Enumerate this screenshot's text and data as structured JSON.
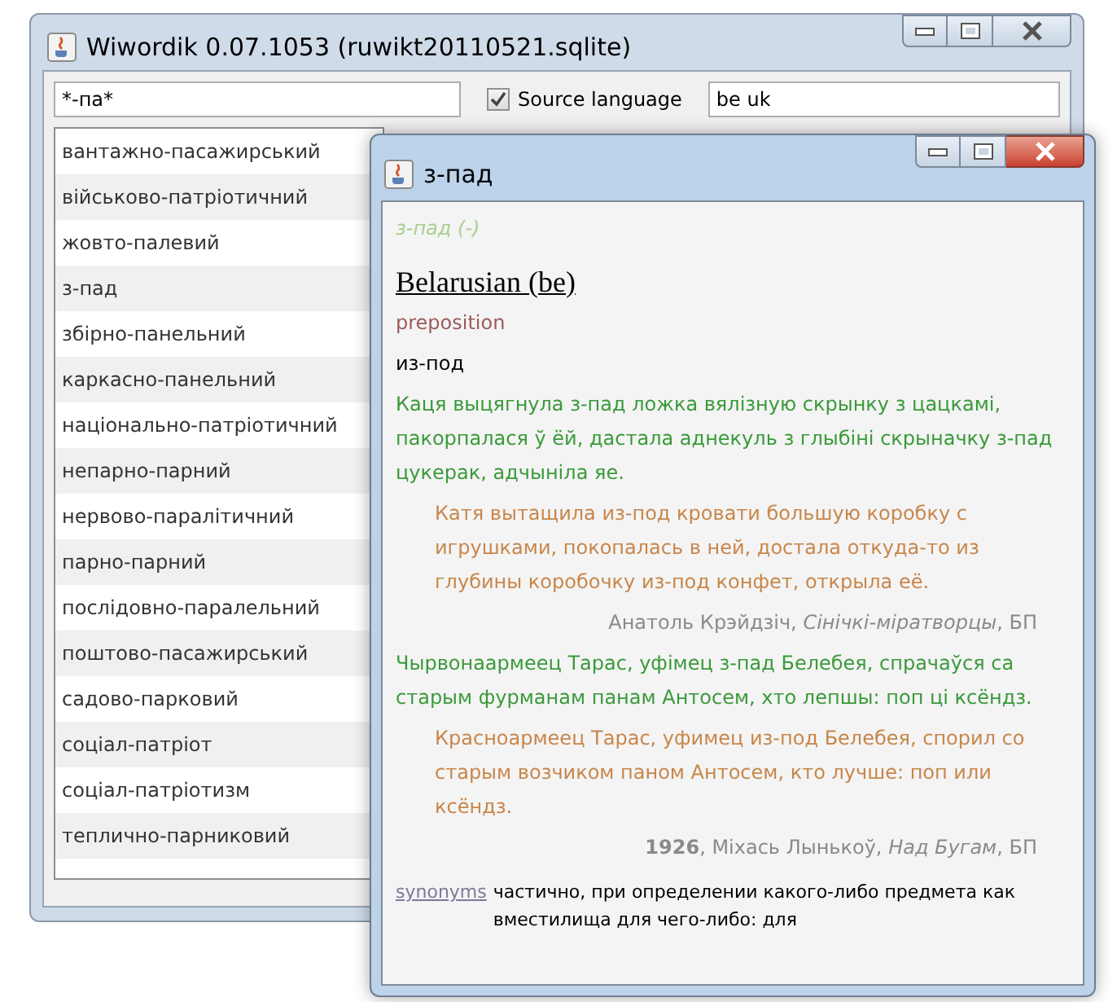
{
  "main_window": {
    "title": "Wiwordik 0.07.1053 (ruwikt20110521.sqlite)",
    "search": {
      "value": "*-па*"
    },
    "source_language": {
      "label": "Source language",
      "checked": true
    },
    "languages": {
      "value": "be uk"
    },
    "words": [
      "вантажно-пасажирський",
      "військово-патріотичний",
      "жовто-палевий",
      "з-пад",
      "збірно-панельний",
      "каркасно-панельний",
      "національно-патріотичний",
      "непарно-парний",
      "нервово-паралітичний",
      "парно-парний",
      "послідовно-паралельний",
      "поштово-пасажирський",
      "садово-парковий",
      "соціал-патріот",
      "соціал-патріотизм",
      "теплично-парниковий"
    ]
  },
  "entry_window": {
    "title": "з-пад",
    "header": "з-пад (-)",
    "language": "Belarusian (be)",
    "part_of_speech": "preposition",
    "translation": "из-под",
    "examples": [
      {
        "text": "Каця выцягнула з-пад ложка вялізную скрынку з цацкамі, пакорпалася ў ёй, дастала аднекуль з глыбіні скрыначку з-пад цукерак, адчыніла яе.",
        "translation": "Катя вытащила из-под кровати большую коробку с игрушками, покопалась в ней, достала откуда-то из глубины коробочку из-под конфет, открыла её.",
        "source": "Анатоль Крэйдзіч, *Сінічкі-міратворцы*, БП"
      },
      {
        "text": "Чырвонаармеец Тарас, уфімец з-пад Белебея, спрачаўся са старым фурманам панам Антосем, хто лепшы: поп ці ксёндз.",
        "translation": "Красноармеец Тарас, уфимец из-под Белебея, спорил со старым возчиком паном Антосем, кто лучше: поп или ксёндз.",
        "source": "**1926**, Міхась Лынькоў, *Над Бугам*, БП"
      }
    ],
    "synonyms": {
      "label": "synonyms",
      "text": "частично, при определении какого-либо предмета как вместилища для чего-либо: для"
    }
  }
}
